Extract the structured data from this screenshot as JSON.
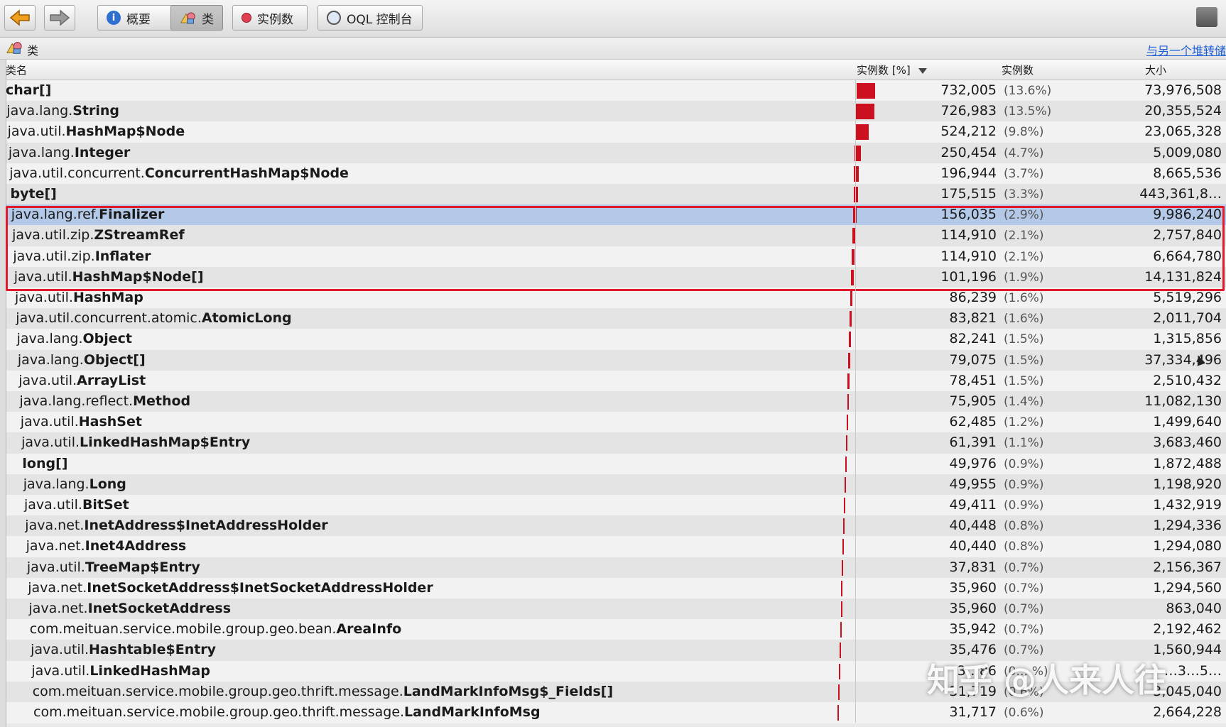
{
  "toolbar": {
    "buttons": [
      {
        "label": "概要",
        "icon": "info-icon"
      },
      {
        "label": "类",
        "icon": "classes-icon"
      },
      {
        "label": "实例数",
        "icon": "instance-icon"
      },
      {
        "label": "OQL 控制台",
        "icon": "oql-icon"
      }
    ],
    "active_button": "类",
    "accent": "#cc1020"
  },
  "strip": {
    "title": "类",
    "compare_link": "与另一个堆转储"
  },
  "table": {
    "headers": {
      "name": "类名",
      "percent": "实例数 [%]",
      "count": "实例数",
      "size": "大小"
    },
    "rows": [
      {
        "pkg": "",
        "cls": "char[]",
        "count": "732,005",
        "pct": "(13.6%)",
        "size": "73,976,508",
        "share": 13.6
      },
      {
        "pkg": "java.lang.",
        "cls": "String",
        "count": "726,983",
        "pct": "(13.5%)",
        "size": "20,355,524",
        "share": 13.5
      },
      {
        "pkg": "java.util.",
        "cls": "HashMap$Node",
        "count": "524,212",
        "pct": "(9.8%)",
        "size": "23,065,328",
        "share": 9.8
      },
      {
        "pkg": "java.lang.",
        "cls": "Integer",
        "count": "250,454",
        "pct": "(4.7%)",
        "size": "5,009,080",
        "share": 4.7
      },
      {
        "pkg": "java.util.concurrent.",
        "cls": "ConcurrentHashMap$Node",
        "count": "196,944",
        "pct": "(3.7%)",
        "size": "8,665,536",
        "share": 3.7
      },
      {
        "pkg": "",
        "cls": "byte[]",
        "count": "175,515",
        "pct": "(3.3%)",
        "size": "443,361,8…",
        "share": 3.3
      },
      {
        "pkg": "java.lang.ref.",
        "cls": "Finalizer",
        "count": "156,035",
        "pct": "(2.9%)",
        "size": "9,986,240",
        "share": 2.9,
        "selected": true
      },
      {
        "pkg": "java.util.zip.",
        "cls": "ZStreamRef",
        "count": "114,910",
        "pct": "(2.1%)",
        "size": "2,757,840",
        "share": 2.1
      },
      {
        "pkg": "java.util.zip.",
        "cls": "Inflater",
        "count": "114,910",
        "pct": "(2.1%)",
        "size": "6,664,780",
        "share": 2.1
      },
      {
        "pkg": "java.util.",
        "cls": "HashMap$Node[]",
        "count": "101,196",
        "pct": "(1.9%)",
        "size": "14,131,824",
        "share": 1.9
      },
      {
        "pkg": "java.util.",
        "cls": "HashMap",
        "count": "86,239",
        "pct": "(1.6%)",
        "size": "5,519,296",
        "share": 1.6
      },
      {
        "pkg": "java.util.concurrent.atomic.",
        "cls": "AtomicLong",
        "count": "83,821",
        "pct": "(1.6%)",
        "size": "2,011,704",
        "share": 1.6
      },
      {
        "pkg": "java.lang.",
        "cls": "Object",
        "count": "82,241",
        "pct": "(1.5%)",
        "size": "1,315,856",
        "share": 1.5
      },
      {
        "pkg": "java.lang.",
        "cls": "Object[]",
        "count": "79,075",
        "pct": "(1.5%)",
        "size": "37,334,496",
        "share": 1.5
      },
      {
        "pkg": "java.util.",
        "cls": "ArrayList",
        "count": "78,451",
        "pct": "(1.5%)",
        "size": "2,510,432",
        "share": 1.5
      },
      {
        "pkg": "java.lang.reflect.",
        "cls": "Method",
        "count": "75,905",
        "pct": "(1.4%)",
        "size": "11,082,130",
        "share": 1.4
      },
      {
        "pkg": "java.util.",
        "cls": "HashSet",
        "count": "62,485",
        "pct": "(1.2%)",
        "size": "1,499,640",
        "share": 1.2
      },
      {
        "pkg": "java.util.",
        "cls": "LinkedHashMap$Entry",
        "count": "61,391",
        "pct": "(1.1%)",
        "size": "3,683,460",
        "share": 1.1
      },
      {
        "pkg": "",
        "cls": "long[]",
        "count": "49,976",
        "pct": "(0.9%)",
        "size": "1,872,488",
        "share": 0.9
      },
      {
        "pkg": "java.lang.",
        "cls": "Long",
        "count": "49,955",
        "pct": "(0.9%)",
        "size": "1,198,920",
        "share": 0.9
      },
      {
        "pkg": "java.util.",
        "cls": "BitSet",
        "count": "49,411",
        "pct": "(0.9%)",
        "size": "1,432,919",
        "share": 0.9
      },
      {
        "pkg": "java.net.",
        "cls": "InetAddress$InetAddressHolder",
        "count": "40,448",
        "pct": "(0.8%)",
        "size": "1,294,336",
        "share": 0.8
      },
      {
        "pkg": "java.net.",
        "cls": "Inet4Address",
        "count": "40,440",
        "pct": "(0.8%)",
        "size": "1,294,080",
        "share": 0.8
      },
      {
        "pkg": "java.util.",
        "cls": "TreeMap$Entry",
        "count": "37,831",
        "pct": "(0.7%)",
        "size": "2,156,367",
        "share": 0.7
      },
      {
        "pkg": "java.net.",
        "cls": "InetSocketAddress$InetSocketAddressHolder",
        "count": "35,960",
        "pct": "(0.7%)",
        "size": "1,294,560",
        "share": 0.7
      },
      {
        "pkg": "java.net.",
        "cls": "InetSocketAddress",
        "count": "35,960",
        "pct": "(0.7%)",
        "size": "863,040",
        "share": 0.7
      },
      {
        "pkg": "com.meituan.service.mobile.group.geo.bean.",
        "cls": "AreaInfo",
        "count": "35,942",
        "pct": "(0.7%)",
        "size": "2,192,462",
        "share": 0.7
      },
      {
        "pkg": "java.util.",
        "cls": "Hashtable$Entry",
        "count": "35,476",
        "pct": "(0.7%)",
        "size": "1,560,944",
        "share": 0.7
      },
      {
        "pkg": "java.util.",
        "cls": "LinkedHashMap",
        "count": "3…86",
        "pct": "(0.…%)",
        "size": "…3…5…",
        "share": 0.6
      },
      {
        "pkg": "com.meituan.service.mobile.group.geo.thrift.message.",
        "cls": "LandMarkInfoMsg$_Fields[]",
        "count": "31,719",
        "pct": "(0.6%)",
        "size": "3,045,040",
        "share": 0.6
      },
      {
        "pkg": "com.meituan.service.mobile.group.geo.thrift.message.",
        "cls": "LandMarkInfoMsg",
        "count": "31,717",
        "pct": "(0.6%)",
        "size": "2,664,228",
        "share": 0.6
      }
    ]
  },
  "watermark": "知乎 @人来人往"
}
